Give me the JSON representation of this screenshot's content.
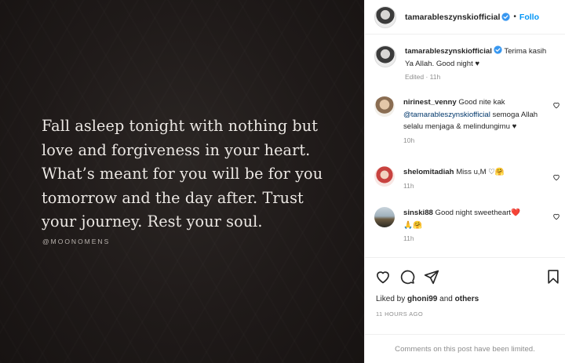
{
  "post": {
    "quote_lines": [
      "Fall asleep tonight with nothing but",
      "love and forgiveness in your heart.",
      "What’s meant for you will be for you",
      "tomorrow and the day after. Trust",
      "your journey. Rest your soul."
    ],
    "quote_credit": "@MOONOMENS"
  },
  "header": {
    "username": "tamarableszynskiofficial",
    "dot": "•",
    "follow_label": "Follo"
  },
  "caption": {
    "username": "tamarableszynskiofficial",
    "text": "Terima kasih Ya Allah. Good night ♥",
    "meta": "Edited · 11h"
  },
  "comments": [
    {
      "username": "nirinest_venny",
      "text_before": "Good nite kak",
      "mention": "@tamarableszynskiofficial",
      "text_after": "semoga Allah selalu menjaga & melindungimu ♥",
      "time": "10h"
    },
    {
      "username": "shelomitadiah",
      "text": "Miss u,M ♡🤗",
      "time": "11h"
    },
    {
      "username": "sinski88",
      "text": "Good night sweetheart❤️🙏🤗",
      "time": "11h"
    }
  ],
  "engagement": {
    "liked_by_prefix": "Liked by",
    "liked_user": "ghoni99",
    "and_word": "and",
    "others": "others",
    "posted_ago": "11 HOURS AGO"
  },
  "footer": {
    "comments_limited": "Comments on this post have been limited."
  },
  "colors": {
    "accent": "#0095f6",
    "verified": "#3897f0",
    "muted": "#8e8e8e",
    "mention": "#00376b"
  },
  "icons": [
    "verified-badge-icon",
    "heart-icon",
    "comment-icon",
    "share-icon",
    "bookmark-icon",
    "like-comment-icon"
  ]
}
